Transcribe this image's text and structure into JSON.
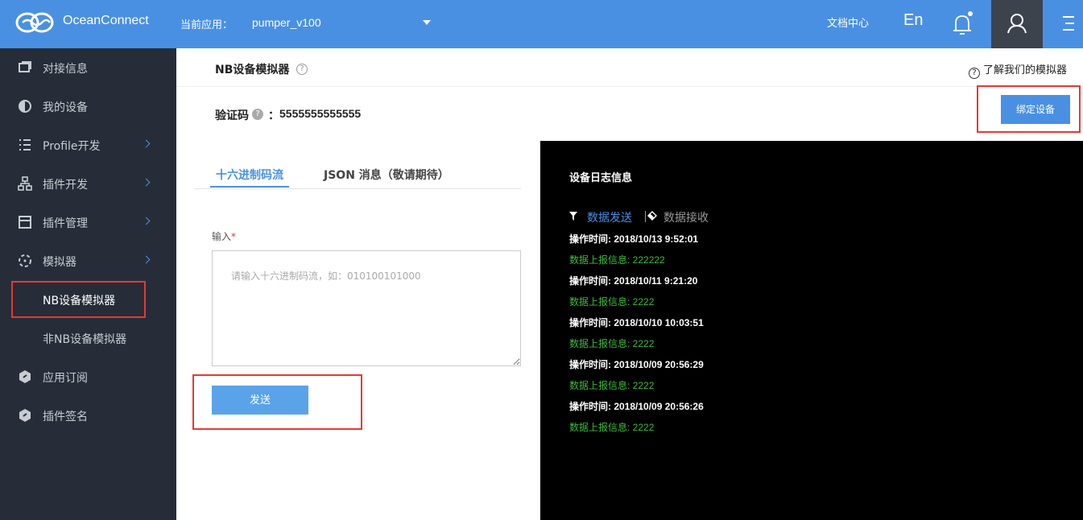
{
  "header": {
    "brand": "OceanConnect",
    "current_app_label": "当前应用：",
    "current_app": "pumper_v100",
    "docs": "文档中心",
    "lang": "En"
  },
  "sidebar": {
    "items": [
      {
        "label": "对接信息",
        "icon": "window-icon"
      },
      {
        "label": "我的设备",
        "icon": "device-icon"
      },
      {
        "label": "Profile开发",
        "icon": "list-icon"
      },
      {
        "label": "插件开发",
        "icon": "hierarchy-icon"
      },
      {
        "label": "插件管理",
        "icon": "panel-icon"
      },
      {
        "label": "模拟器",
        "icon": "simulator-icon"
      },
      {
        "label": "NB设备模拟器",
        "icon": ""
      },
      {
        "label": "非NB设备模拟器",
        "icon": ""
      },
      {
        "label": "应用订阅",
        "icon": "hexagon-icon"
      },
      {
        "label": "插件签名",
        "icon": "hexagon-icon"
      }
    ]
  },
  "main": {
    "title": "NB设备模拟器",
    "learn_link": "了解我们的模拟器",
    "verify_label": "验证码",
    "verify_colon": "：",
    "verify_value": "5555555555555",
    "bind_button": "绑定设备",
    "tabs": [
      "十六进制码流",
      "JSON 消息（敬请期待）"
    ],
    "input_label": "输入",
    "input_required": "*",
    "input_placeholder": "请输入十六进制码流，如：010100101000",
    "send_button": "发送"
  },
  "log": {
    "title": "设备日志信息",
    "filter_send": "数据发送",
    "filter_recv": "数据接收",
    "entries": [
      {
        "time": "操作时间: 2018/10/13 9:52:01",
        "data": "数据上报信息: 222222"
      },
      {
        "time": "操作时间: 2018/10/11 9:21:20",
        "data": "数据上报信息: 2222"
      },
      {
        "time": "操作时间: 2018/10/10 10:03:51",
        "data": "数据上报信息: 2222"
      },
      {
        "time": "操作时间: 2018/10/09 20:56:29",
        "data": "数据上报信息: 2222"
      },
      {
        "time": "操作时间: 2018/10/09 20:56:26",
        "data": "数据上报信息: 2222"
      }
    ]
  },
  "colors": {
    "topbar": "#4a90e2",
    "sidebar": "#262d38",
    "accent": "#4a90e2",
    "highlight": "#e53935",
    "log_bg": "#000000",
    "log_data": "#3dbb3d"
  }
}
